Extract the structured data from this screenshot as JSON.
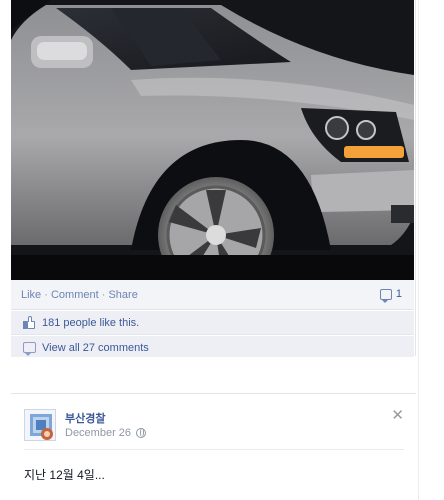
{
  "post1": {
    "actions": {
      "like": "Like",
      "comment": "Comment",
      "share": "Share",
      "separator": "·",
      "comment_count": "1"
    },
    "likes_text": "181 people like this.",
    "view_comments_text": "View all 27 comments"
  },
  "post2": {
    "author": "부산경찰",
    "date": "December 26",
    "text": "지난 12월 4일..."
  },
  "colors": {
    "link": "#3b5998",
    "muted": "#9197a3",
    "strip_bg": "#edeff4"
  },
  "icons": [
    "like-thumb-icon",
    "comment-bubble-icon",
    "globe-icon",
    "close-icon"
  ]
}
